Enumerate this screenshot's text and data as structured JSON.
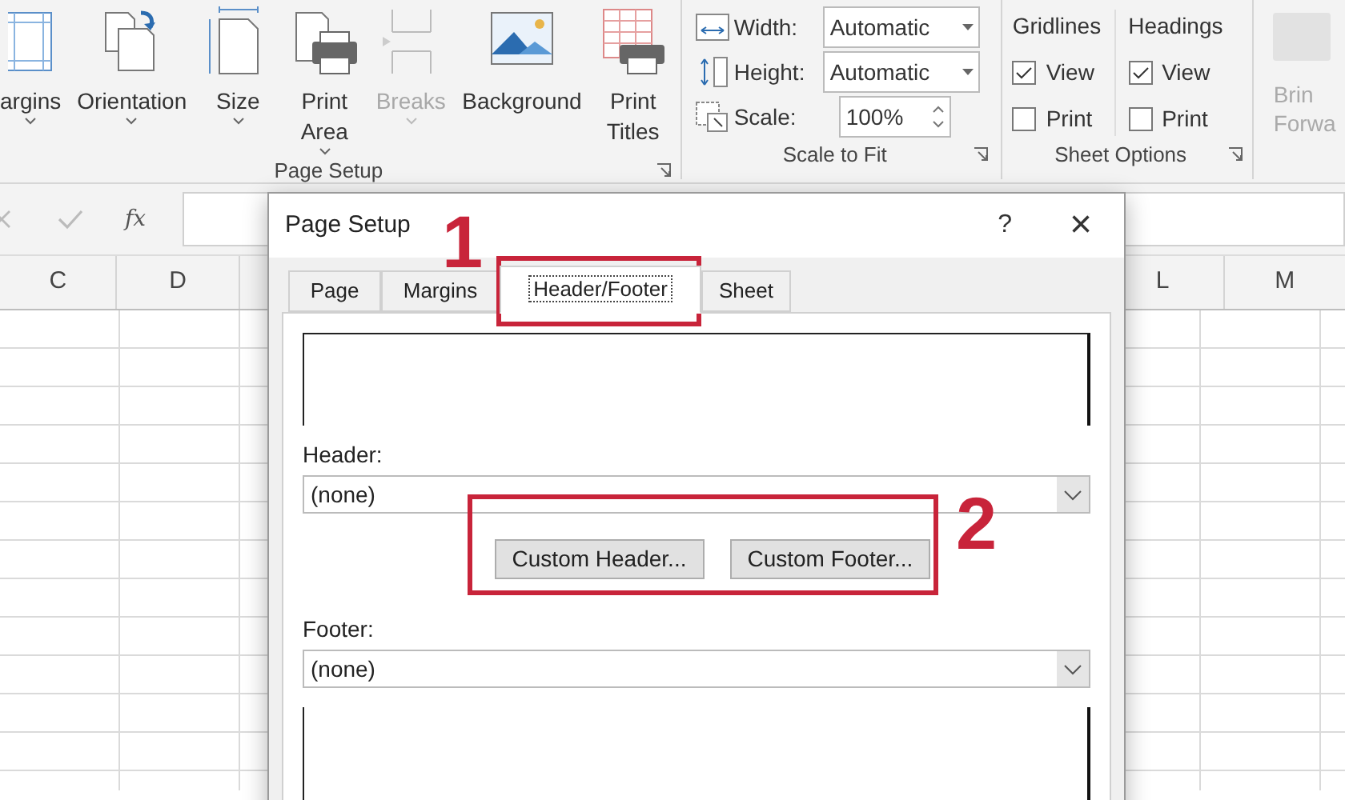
{
  "ribbon": {
    "groups": [
      {
        "kind": "buttons",
        "label": "Page Setup",
        "items": [
          {
            "label": "argins",
            "disabled": false,
            "dropdown": true
          },
          {
            "label": "Orientation",
            "disabled": false,
            "dropdown": true
          },
          {
            "label": "Size",
            "disabled": false,
            "dropdown": true
          },
          {
            "label": "Print Area",
            "disabled": false,
            "dropdown": true
          },
          {
            "label": "Breaks",
            "disabled": true,
            "dropdown": true
          },
          {
            "label": "Background",
            "disabled": false,
            "dropdown": false
          },
          {
            "label": "Print Titles",
            "disabled": false,
            "dropdown": false
          }
        ]
      },
      {
        "kind": "scale",
        "label": "Scale to Fit",
        "rows": [
          {
            "label": "Width:",
            "value": "Automatic",
            "kind": "dropdown"
          },
          {
            "label": "Height:",
            "value": "Automatic",
            "kind": "dropdown"
          },
          {
            "label": "Scale:",
            "value": "100%",
            "kind": "spinner"
          }
        ]
      },
      {
        "kind": "sheet",
        "label": "Sheet Options",
        "columns": [
          {
            "title": "Gridlines",
            "options": [
              {
                "label": "View",
                "checked": true
              },
              {
                "label": "Print",
                "checked": false
              }
            ]
          },
          {
            "title": "Headings",
            "options": [
              {
                "label": "View",
                "checked": true
              },
              {
                "label": "Print",
                "checked": false
              }
            ]
          }
        ]
      },
      {
        "kind": "cut",
        "lines": [
          "Brin",
          "Forwa"
        ]
      }
    ]
  },
  "formula_bar": {
    "fx": "fx"
  },
  "columns_left": [
    "C",
    "D"
  ],
  "columns_right": [
    "L",
    "M"
  ],
  "dialog": {
    "title": "Page Setup",
    "help": "?",
    "close": "×",
    "tabs": [
      {
        "label": "Page",
        "selected": false
      },
      {
        "label": "Margins",
        "selected": false
      },
      {
        "label": "Header/Footer",
        "selected": true
      },
      {
        "label": "Sheet",
        "selected": false
      }
    ],
    "header_label": "Header:",
    "header_value": "(none)",
    "buttons": [
      "Custom Header...",
      "Custom Footer..."
    ],
    "footer_label": "Footer:",
    "footer_value": "(none)"
  },
  "annotations": [
    {
      "number": "1"
    },
    {
      "number": "2"
    }
  ]
}
